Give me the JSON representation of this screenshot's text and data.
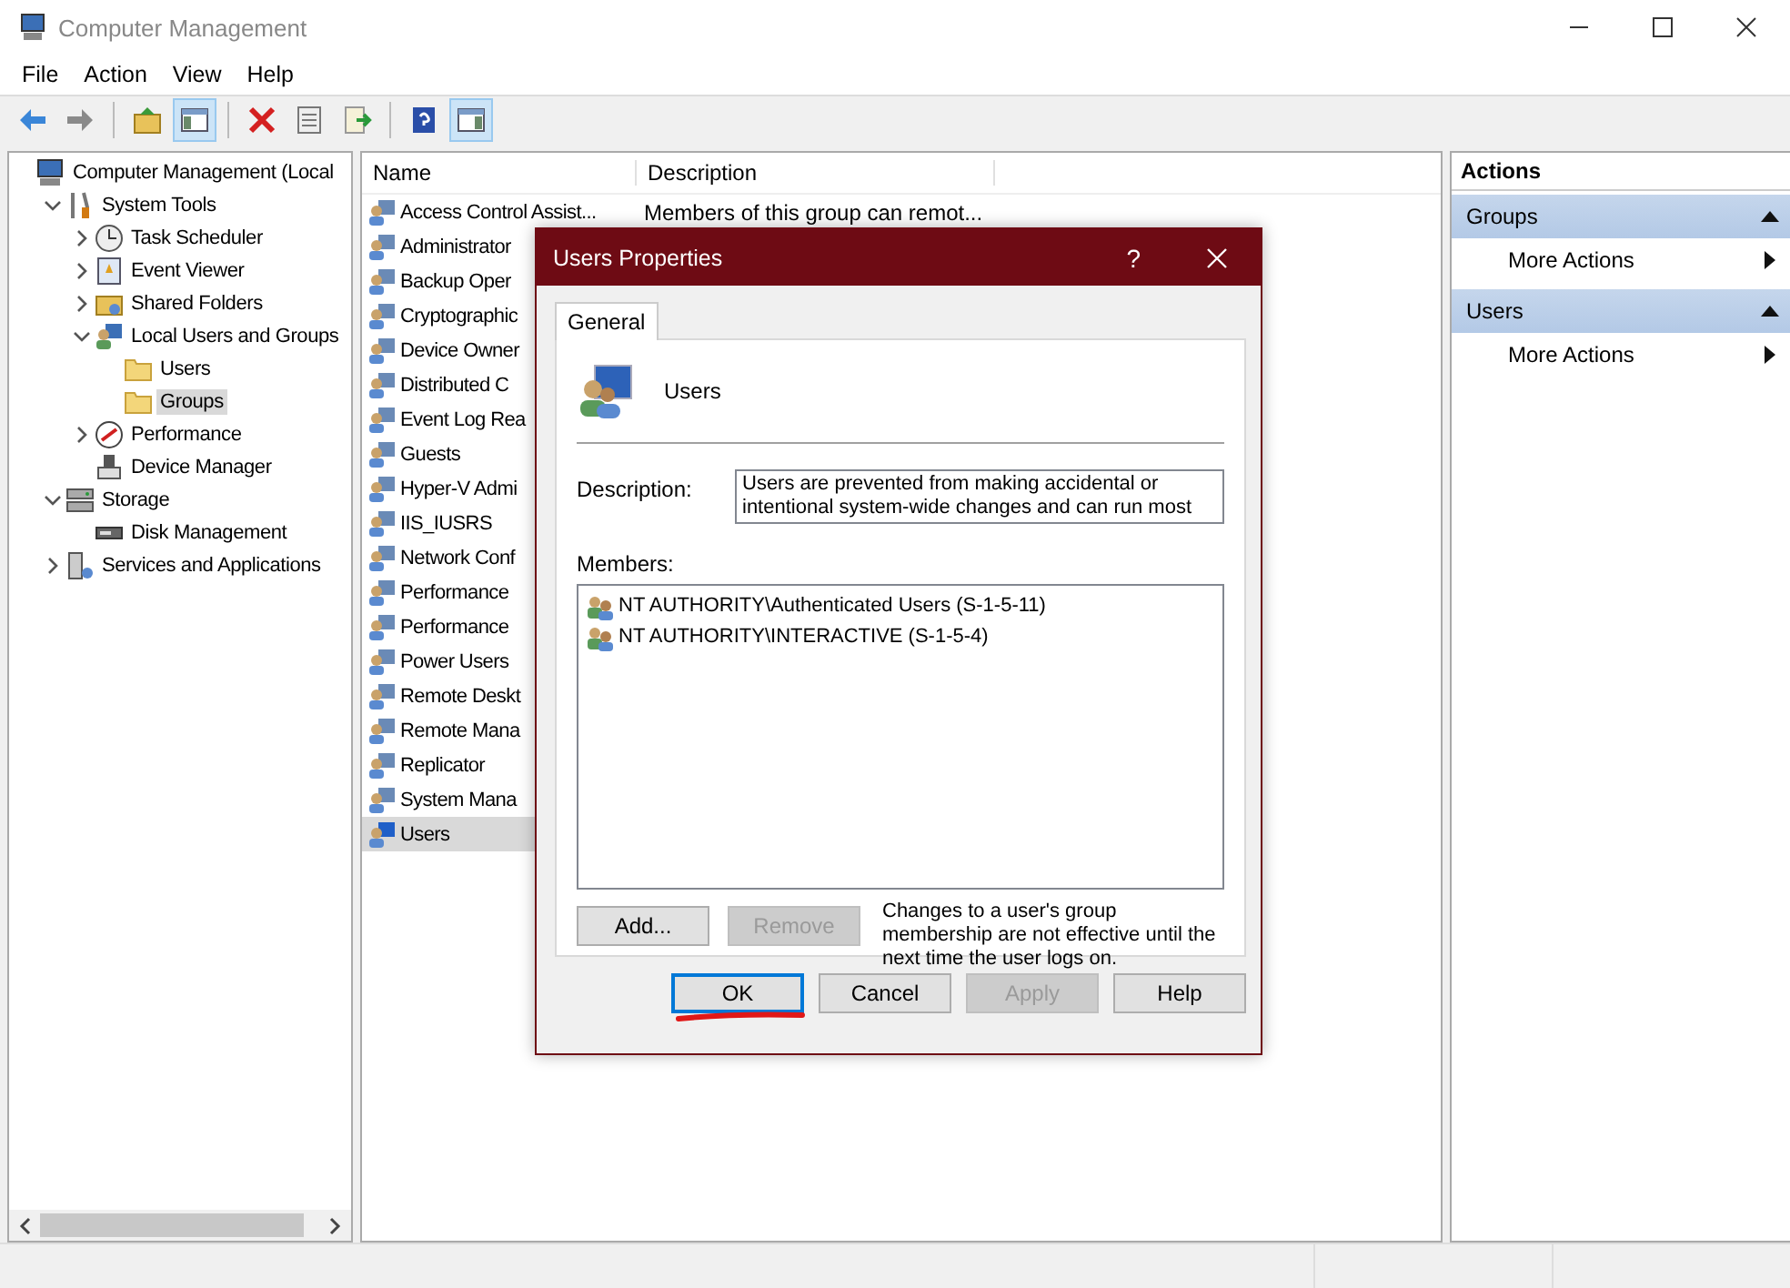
{
  "window": {
    "title": "Computer Management"
  },
  "menu": [
    "File",
    "Action",
    "View",
    "Help"
  ],
  "toolbar": [
    {
      "kind": "back",
      "pressed": false
    },
    {
      "kind": "forward",
      "pressed": false
    },
    {
      "kind": "sep"
    },
    {
      "kind": "up",
      "pressed": false
    },
    {
      "kind": "tree",
      "pressed": true
    },
    {
      "kind": "sep"
    },
    {
      "kind": "delete",
      "pressed": false
    },
    {
      "kind": "props",
      "pressed": false
    },
    {
      "kind": "export",
      "pressed": false
    },
    {
      "kind": "sep"
    },
    {
      "kind": "help",
      "pressed": false
    },
    {
      "kind": "pane",
      "pressed": true
    }
  ],
  "tree": [
    {
      "label": "Computer Management (Local",
      "kind": "computer",
      "selected": false,
      "children": [
        {
          "label": "System Tools",
          "kind": "tools",
          "expanded": true,
          "selected": false,
          "children": [
            {
              "label": "Task Scheduler",
              "kind": "clock",
              "expanded": false,
              "selected": false
            },
            {
              "label": "Event Viewer",
              "kind": "log",
              "expanded": false,
              "selected": false
            },
            {
              "label": "Shared Folders",
              "kind": "share",
              "expanded": false,
              "selected": false
            },
            {
              "label": "Local Users and Groups",
              "kind": "group",
              "expanded": true,
              "selected": false,
              "children": [
                {
                  "label": "Users",
                  "kind": "folder",
                  "selected": false
                },
                {
                  "label": "Groups",
                  "kind": "folder",
                  "selected": true
                }
              ]
            },
            {
              "label": "Performance",
              "kind": "gauge",
              "expanded": false,
              "selected": false
            },
            {
              "label": "Device Manager",
              "kind": "device",
              "selected": false
            }
          ]
        },
        {
          "label": "Storage",
          "kind": "storage",
          "expanded": true,
          "selected": false,
          "children": [
            {
              "label": "Disk Management",
              "kind": "disk",
              "selected": false
            }
          ]
        },
        {
          "label": "Services and Applications",
          "kind": "services",
          "expanded": false,
          "selected": false
        }
      ]
    }
  ],
  "list": {
    "columns": [
      "Name",
      "Description"
    ],
    "rows": [
      {
        "name": "Access Control Assist...",
        "description": "Members of this group can remot...",
        "selected": false
      },
      {
        "name": "Administrator",
        "selected": false
      },
      {
        "name": "Backup Oper",
        "selected": false
      },
      {
        "name": "Cryptographic",
        "selected": false
      },
      {
        "name": "Device Owner",
        "selected": false
      },
      {
        "name": "Distributed C",
        "selected": false
      },
      {
        "name": "Event Log Rea",
        "selected": false
      },
      {
        "name": "Guests",
        "selected": false
      },
      {
        "name": "Hyper-V Admi",
        "selected": false
      },
      {
        "name": "IIS_IUSRS",
        "selected": false
      },
      {
        "name": "Network Conf",
        "selected": false
      },
      {
        "name": "Performance",
        "selected": false
      },
      {
        "name": "Performance",
        "selected": false
      },
      {
        "name": "Power Users",
        "selected": false
      },
      {
        "name": "Remote Deskt",
        "selected": false
      },
      {
        "name": "Remote Mana",
        "selected": false
      },
      {
        "name": "Replicator",
        "selected": false
      },
      {
        "name": "System Mana",
        "selected": false
      },
      {
        "name": "Users",
        "selected": true
      }
    ]
  },
  "actions": {
    "title": "Actions",
    "sections": [
      {
        "title": "Groups",
        "items": [
          "More Actions"
        ]
      },
      {
        "title": "Users",
        "items": [
          "More Actions"
        ]
      }
    ]
  },
  "dialog": {
    "title": "Users Properties",
    "help": "?",
    "tabs": [
      {
        "label": "General",
        "selected": true
      }
    ],
    "group_name": "Users",
    "description_label": "Description:",
    "description": "Users are prevented from making accidental or intentional system-wide changes and can run most",
    "members_label": "Members:",
    "members": [
      "NT AUTHORITY\\Authenticated Users (S-1-5-11)",
      "NT AUTHORITY\\INTERACTIVE (S-1-5-4)"
    ],
    "member_buttons": [
      {
        "label": "Add...",
        "disabled": false
      },
      {
        "label": "Remove",
        "disabled": true
      }
    ],
    "note": "Changes to a user's group membership are not effective until the next time the user logs on.",
    "buttons": [
      {
        "label": "OK",
        "disabled": false,
        "focused": true
      },
      {
        "label": "Cancel",
        "disabled": false,
        "focused": false
      },
      {
        "label": "Apply",
        "disabled": true,
        "focused": false
      },
      {
        "label": "Help",
        "disabled": false,
        "focused": false
      }
    ]
  }
}
